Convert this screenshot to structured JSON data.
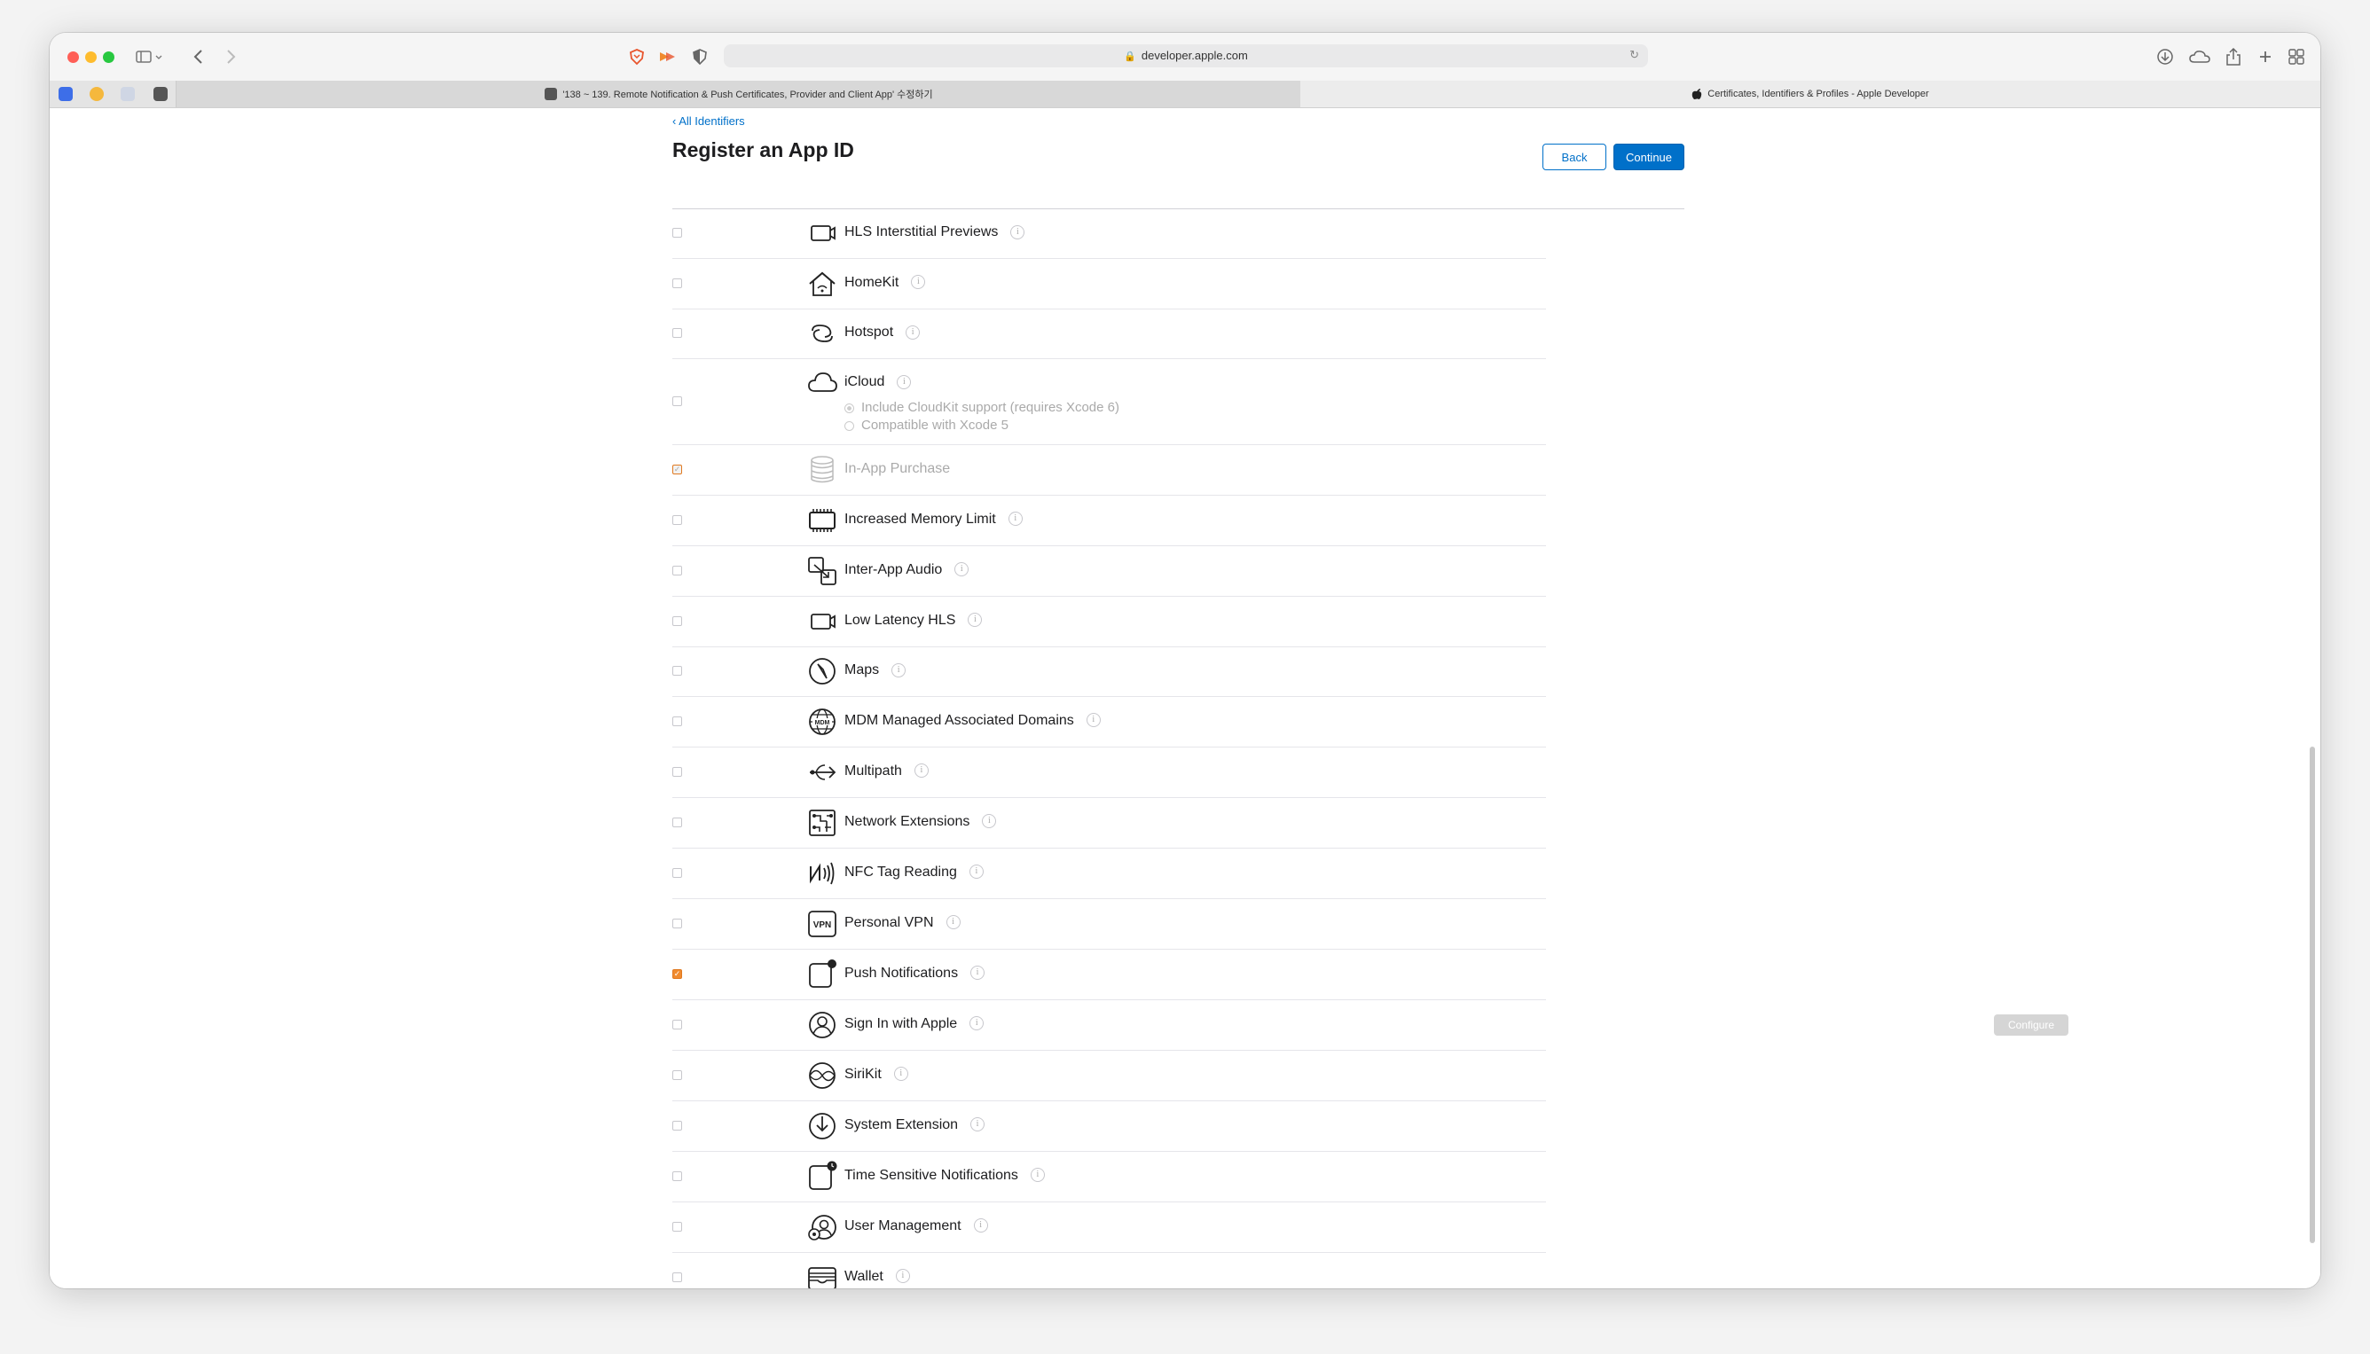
{
  "browser": {
    "url": "developer.apple.com",
    "tabs": [
      {
        "label": "'138 ~ 139. Remote Notification & Push Certificates, Provider and Client App' 수정하기"
      },
      {
        "label": "Certificates, Identifiers & Profiles - Apple Developer"
      }
    ],
    "icons": [
      "sidebar-icon",
      "back-arrow-icon",
      "forward-arrow-icon",
      "brave-shield-icon",
      "extension-icon",
      "privacy-icon",
      "lock-icon",
      "reload-icon",
      "download-icon",
      "cloud-icon",
      "share-icon",
      "new-tab-icon",
      "tab-overview-icon"
    ]
  },
  "page": {
    "back_link": "‹ All Identifiers",
    "title": "Register an App ID",
    "back_button": "Back",
    "continue_button": "Continue"
  },
  "capabilities": [
    {
      "label": "HLS Interstitial Previews",
      "icon": "video-icon",
      "checked": false
    },
    {
      "label": "HomeKit",
      "icon": "home-icon",
      "checked": false
    },
    {
      "label": "Hotspot",
      "icon": "hotspot-icon",
      "checked": false
    },
    {
      "label": "iCloud",
      "icon": "cloud-icon",
      "checked": false,
      "options": [
        "Include CloudKit support (requires Xcode 6)",
        "Compatible with Xcode 5"
      ]
    },
    {
      "label": "In-App Purchase",
      "icon": "coins-icon",
      "checked": true,
      "disabled": true
    },
    {
      "label": "Increased Memory Limit",
      "icon": "memory-chip-icon",
      "checked": false
    },
    {
      "label": "Inter-App Audio",
      "icon": "inter-app-audio-icon",
      "checked": false
    },
    {
      "label": "Low Latency HLS",
      "icon": "video-icon",
      "checked": false
    },
    {
      "label": "Maps",
      "icon": "compass-icon",
      "checked": false
    },
    {
      "label": "MDM Managed Associated Domains",
      "icon": "globe-icon",
      "checked": false
    },
    {
      "label": "Multipath",
      "icon": "multipath-icon",
      "checked": false
    },
    {
      "label": "Network Extensions",
      "icon": "network-extensions-icon",
      "checked": false
    },
    {
      "label": "NFC Tag Reading",
      "icon": "nfc-icon",
      "checked": false
    },
    {
      "label": "Personal VPN",
      "icon": "vpn-icon",
      "checked": false
    },
    {
      "label": "Push Notifications",
      "icon": "notification-icon",
      "checked": true
    },
    {
      "label": "Sign In with Apple",
      "icon": "person-icon",
      "checked": false,
      "configure": "Configure"
    },
    {
      "label": "SiriKit",
      "icon": "siri-icon",
      "checked": false
    },
    {
      "label": "System Extension",
      "icon": "system-extension-icon",
      "checked": false
    },
    {
      "label": "Time Sensitive Notifications",
      "icon": "time-sensitive-icon",
      "checked": false
    },
    {
      "label": "User Management",
      "icon": "user-management-icon",
      "checked": false
    },
    {
      "label": "Wallet",
      "icon": "wallet-icon",
      "checked": false
    }
  ],
  "info_glyph": "i",
  "colors": {
    "accent": "#0070c9",
    "checked": "#f08b2f"
  }
}
